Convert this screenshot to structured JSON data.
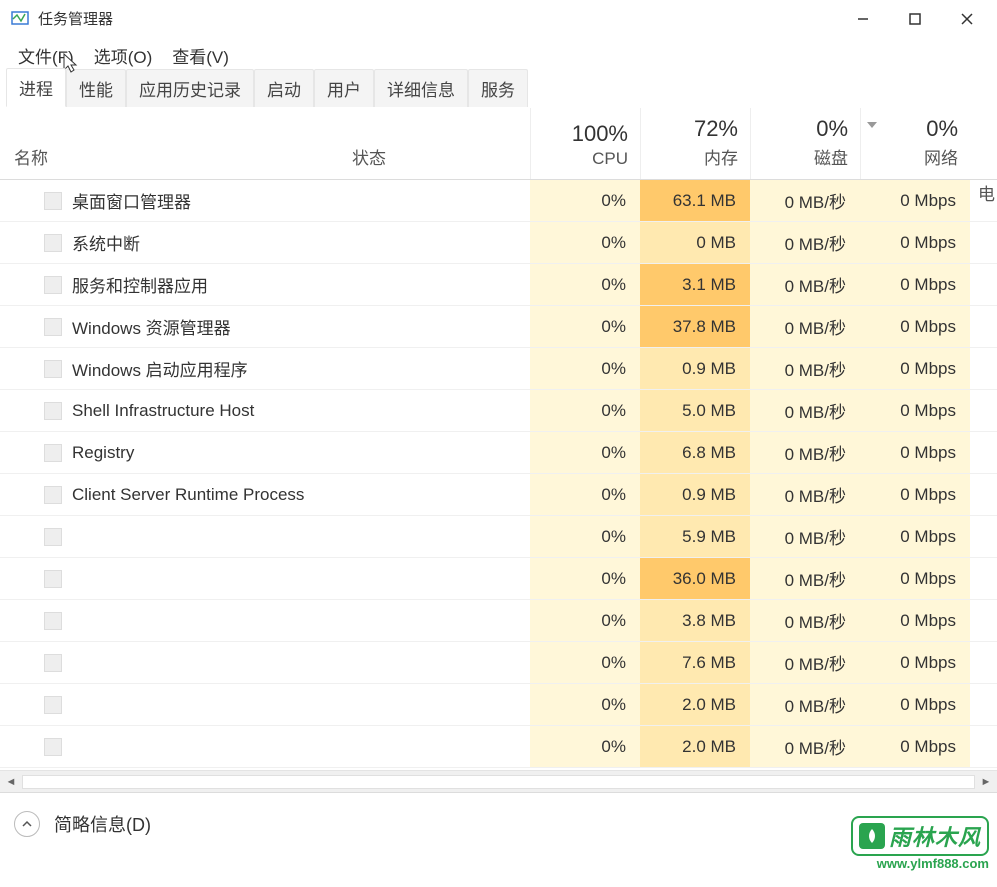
{
  "window": {
    "title": "任务管理器",
    "controls": {
      "minimize": "—",
      "maximize": "□",
      "close": "✕"
    }
  },
  "menubar": [
    {
      "label": "文件(F)"
    },
    {
      "label": "选项(O)"
    },
    {
      "label": "查看(V)"
    }
  ],
  "tabs": [
    {
      "label": "进程",
      "active": true
    },
    {
      "label": "性能"
    },
    {
      "label": "应用历史记录"
    },
    {
      "label": "启动"
    },
    {
      "label": "用户"
    },
    {
      "label": "详细信息"
    },
    {
      "label": "服务"
    }
  ],
  "columns": {
    "name": "名称",
    "status": "状态",
    "cpu": {
      "pct": "100%",
      "label": "CPU"
    },
    "memory": {
      "pct": "72%",
      "label": "内存"
    },
    "disk": {
      "pct": "0%",
      "label": "磁盘"
    },
    "network": {
      "pct": "0%",
      "label": "网络"
    },
    "extra": "电"
  },
  "processes": [
    {
      "name": "桌面窗口管理器",
      "cpu": "0%",
      "mem": "63.1 MB",
      "mem_high": true,
      "disk": "0 MB/秒",
      "net": "0 Mbps"
    },
    {
      "name": "系统中断",
      "cpu": "0%",
      "mem": "0 MB",
      "mem_high": false,
      "disk": "0 MB/秒",
      "net": "0 Mbps"
    },
    {
      "name": "服务和控制器应用",
      "cpu": "0%",
      "mem": "3.1 MB",
      "mem_high": true,
      "disk": "0 MB/秒",
      "net": "0 Mbps"
    },
    {
      "name": "Windows 资源管理器",
      "cpu": "0%",
      "mem": "37.8 MB",
      "mem_high": true,
      "disk": "0 MB/秒",
      "net": "0 Mbps"
    },
    {
      "name": "Windows 启动应用程序",
      "cpu": "0%",
      "mem": "0.9 MB",
      "mem_high": false,
      "disk": "0 MB/秒",
      "net": "0 Mbps"
    },
    {
      "name": "Shell Infrastructure Host",
      "cpu": "0%",
      "mem": "5.0 MB",
      "mem_high": false,
      "disk": "0 MB/秒",
      "net": "0 Mbps"
    },
    {
      "name": "Registry",
      "cpu": "0%",
      "mem": "6.8 MB",
      "mem_high": false,
      "disk": "0 MB/秒",
      "net": "0 Mbps"
    },
    {
      "name": "Client Server Runtime Process",
      "cpu": "0%",
      "mem": "0.9 MB",
      "mem_high": false,
      "disk": "0 MB/秒",
      "net": "0 Mbps"
    },
    {
      "name": "",
      "cpu": "0%",
      "mem": "5.9 MB",
      "mem_high": false,
      "disk": "0 MB/秒",
      "net": "0 Mbps"
    },
    {
      "name": "",
      "cpu": "0%",
      "mem": "36.0 MB",
      "mem_high": true,
      "disk": "0 MB/秒",
      "net": "0 Mbps"
    },
    {
      "name": "",
      "cpu": "0%",
      "mem": "3.8 MB",
      "mem_high": false,
      "disk": "0 MB/秒",
      "net": "0 Mbps"
    },
    {
      "name": "",
      "cpu": "0%",
      "mem": "7.6 MB",
      "mem_high": false,
      "disk": "0 MB/秒",
      "net": "0 Mbps"
    },
    {
      "name": "",
      "cpu": "0%",
      "mem": "2.0 MB",
      "mem_high": false,
      "disk": "0 MB/秒",
      "net": "0 Mbps"
    },
    {
      "name": "",
      "cpu": "0%",
      "mem": "2.0 MB",
      "mem_high": false,
      "disk": "0 MB/秒",
      "net": "0 Mbps"
    }
  ],
  "footer": {
    "brief_label": "简略信息(D)"
  },
  "watermark": {
    "text": "雨林木风",
    "url": "www.ylmf888.com"
  }
}
